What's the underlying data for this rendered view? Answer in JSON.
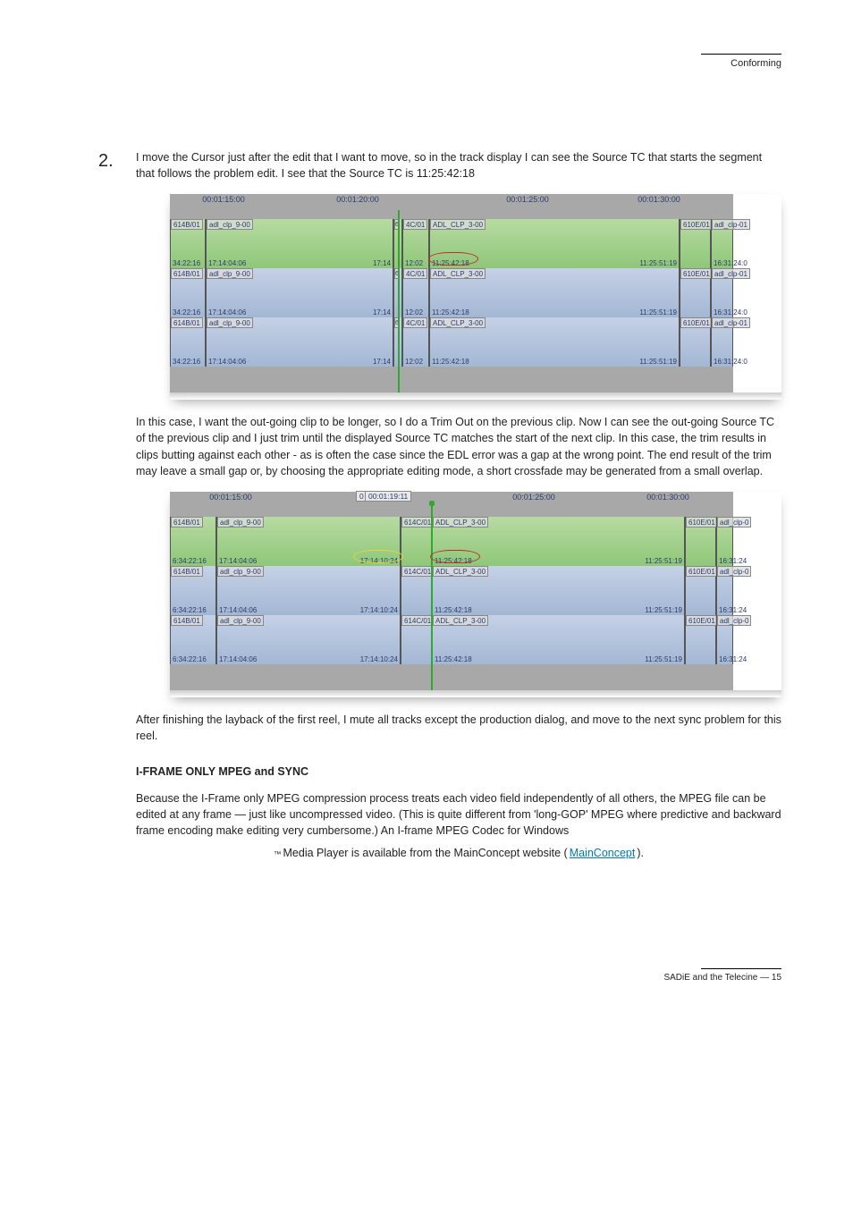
{
  "header": {
    "text": "Conforming"
  },
  "section_num": "2.",
  "para1": "I move the Cursor just after the edit that I want to move, so in the track display I can see the Source TC that starts the segment that follows the problem edit. I see that the Source TC is 11:25:42:18",
  "para2": "In this case, I want the out-going clip to be longer, so I do a Trim Out on the previous clip. Now I can see the out-going Source TC of the previous clip and I just trim until the displayed Source TC matches the start of the next clip. In this case, the trim results in clips butting against each other - as is often the case since the EDL error was a gap at the wrong point. The end result of the trim may leave a small gap or, by choosing the appropriate editing mode, a short crossfade may be generated from a small overlap.",
  "para3": "After finishing the layback of the first reel, I mute all tracks except the production dialog, and move to the next sync problem for this reel.",
  "heading2": "I-FRAME ONLY MPEG and SYNC",
  "para4_a": "Because the I-Frame only MPEG compression process treats each video field independently of all others, the MPEG file can be edited at any frame — just like uncompressed video. (This is quite different from 'long-GOP' MPEG where predictive and backward frame encoding make editing very cumbersome.) An I-frame MPEG Codec for Windows",
  "para4_span": "Media Player is available from the MainConcept website (",
  "para4_link_text": "MainConcept",
  "para4_b": ").",
  "footer": "SADiE and the Telecine — 15",
  "ruler1": [
    "00:01:15:00",
    "00:01:20:00",
    "00:01:25:00",
    "00:01:30:00"
  ],
  "ruler2": [
    "00:01:15:00",
    "00:01:25:00",
    "00:01:30:00"
  ],
  "tooltip2": "00:01:19:11",
  "tooltip2_prefix": "0",
  "clip_ids": {
    "a": "614B/01",
    "b": "adl_clp_9-00",
    "g": "6",
    "c": "4C/01",
    "c2": "614C/01",
    "d": "ADL_CLP_3-00",
    "e": "610E/01",
    "f1": "adl_clp-01",
    "f2": "adl_clp-0"
  },
  "tc": {
    "p_left": "34:22:16",
    "p_left2": "6:34:22:16",
    "a_in": "17:14:04:06",
    "a_out": "17:14",
    "a_out2": "17:14:10:24",
    "c_in_s": "12:02",
    "d_in": "11:25:42:18",
    "d_out": "11:25:51:19",
    "e_in1": "16:31:24:0",
    "e_in2": "16:31:24"
  }
}
